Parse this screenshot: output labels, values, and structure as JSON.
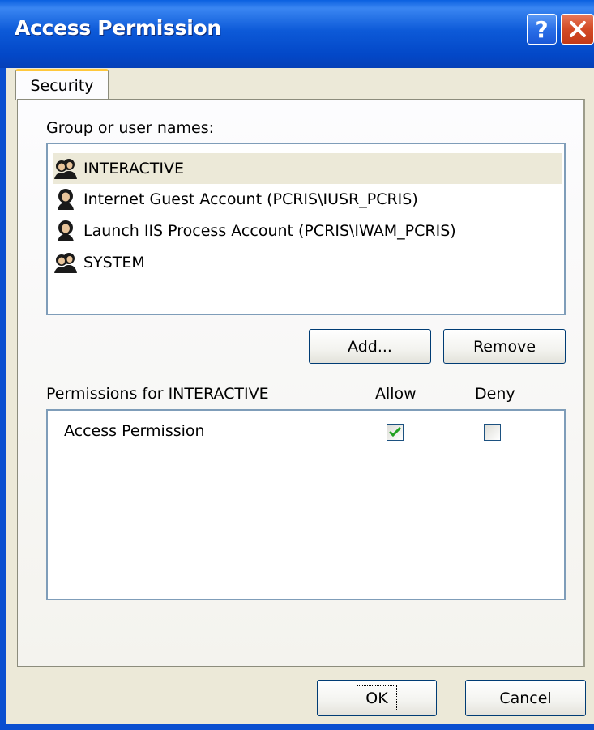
{
  "window": {
    "title": "Access Permission",
    "help_label": "?",
    "tab_label": "Security"
  },
  "group_section": {
    "label": "Group or user names:",
    "items": [
      {
        "label": "INTERACTIVE",
        "icon": "users-group-icon",
        "selected": true
      },
      {
        "label": "Internet Guest Account (PCRIS\\IUSR_PCRIS)",
        "icon": "user-icon",
        "selected": false
      },
      {
        "label": "Launch IIS Process Account (PCRIS\\IWAM_PCRIS)",
        "icon": "user-icon",
        "selected": false
      },
      {
        "label": "SYSTEM",
        "icon": "users-group-icon",
        "selected": false
      }
    ],
    "add_label": "Add...",
    "remove_label": "Remove"
  },
  "permissions": {
    "label": "Permissions for INTERACTIVE",
    "allow_header": "Allow",
    "deny_header": "Deny",
    "rows": [
      {
        "name": "Access Permission",
        "allow": true,
        "deny": false
      }
    ]
  },
  "footer": {
    "ok_label": "OK",
    "cancel_label": "Cancel"
  },
  "colors": {
    "titlebar": "#0d5ad8",
    "face": "#ece9d8",
    "list_border": "#7f9db9",
    "check_green": "#21a121"
  }
}
